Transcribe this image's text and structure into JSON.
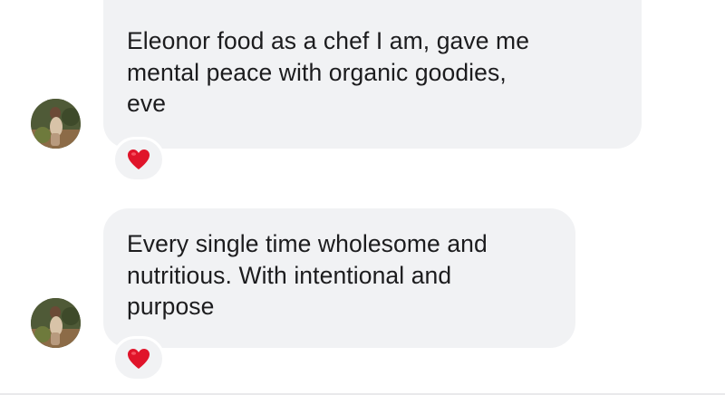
{
  "messages": [
    {
      "text": "Eleonor food as a chef I am, gave me\nmental peace with organic goodies,\neve",
      "reaction": "red-heart-icon"
    },
    {
      "text": "Every single time wholesome and\nnutritious. With intentional and\npurpose",
      "reaction": "red-heart-icon"
    }
  ],
  "colors": {
    "bubble_background": "#f1f2f4",
    "text": "#1c1c1e",
    "heart": "#e0142a"
  }
}
